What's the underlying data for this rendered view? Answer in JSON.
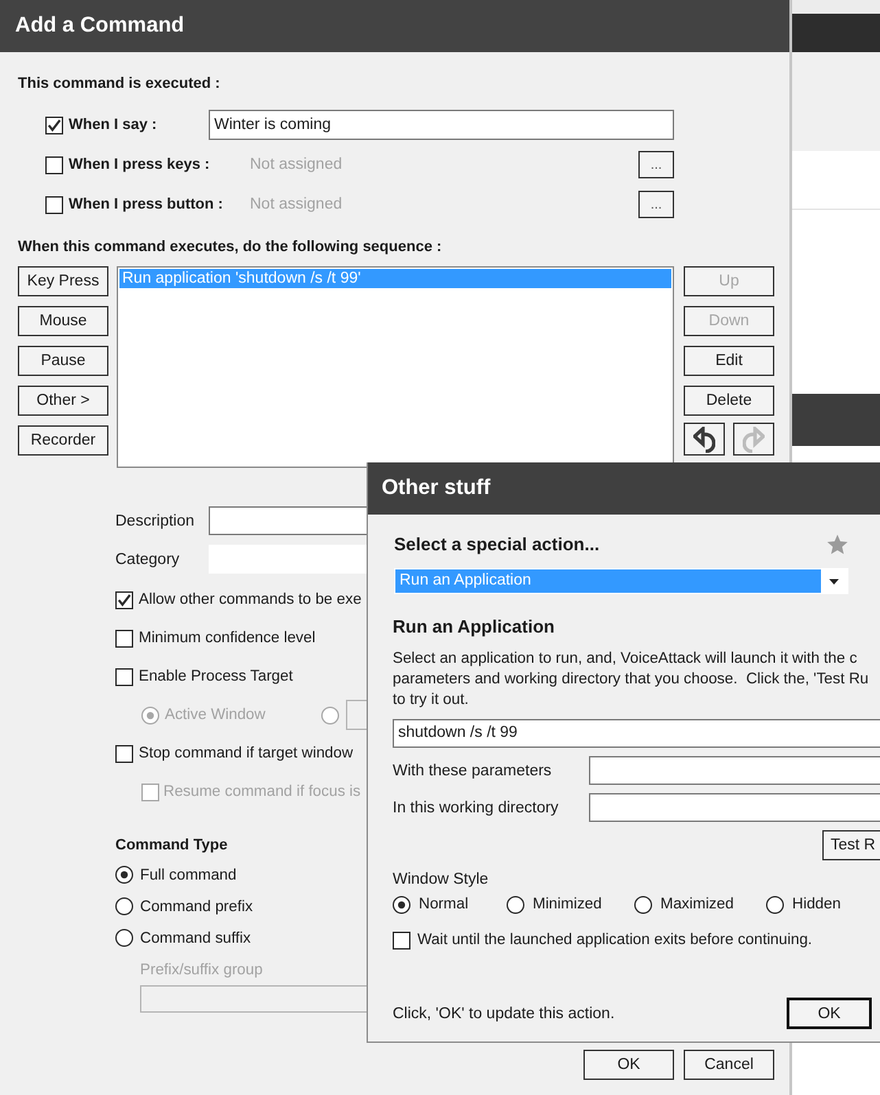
{
  "command_dialog": {
    "title": "Add a Command",
    "trigger_heading": "This command is executed :",
    "triggers": [
      {
        "kind": "phrase",
        "label": "When I say :",
        "checked": true,
        "value": "Winter is coming"
      },
      {
        "kind": "binding",
        "label": "When I press keys :",
        "checked": false,
        "value": "Not assigned",
        "button": "..."
      },
      {
        "kind": "binding",
        "label": "When I press button :",
        "checked": false,
        "value": "Not assigned",
        "button": "..."
      }
    ],
    "sequence_heading": "When this command executes, do the following sequence :",
    "add_buttons": [
      "Key Press",
      "Mouse",
      "Pause",
      "Other >",
      "Recorder"
    ],
    "actions": [
      {
        "label": "Run application 'shutdown /s /t 99'",
        "selected": true
      }
    ],
    "list_buttons": [
      {
        "label": "Up",
        "disabled": true
      },
      {
        "label": "Down",
        "disabled": true
      },
      {
        "label": "Edit",
        "disabled": false
      },
      {
        "label": "Delete",
        "disabled": false
      }
    ],
    "history_buttons": [
      {
        "kind": "undo",
        "disabled": false
      },
      {
        "kind": "redo",
        "disabled": true
      }
    ],
    "fields": [
      {
        "kind": "boxed",
        "label": "Description"
      },
      {
        "kind": "plain",
        "label": "Category"
      }
    ],
    "options": [
      {
        "kind": "checkbox",
        "label": "Allow other commands to be exe",
        "checked": true,
        "disabled": false
      },
      {
        "kind": "checkbox",
        "label": "Minimum confidence level",
        "checked": false,
        "disabled": false
      },
      {
        "kind": "checkbox",
        "label": "Enable Process Target",
        "checked": false,
        "disabled": false
      },
      {
        "kind": "radios",
        "disabled": true,
        "items": [
          {
            "label": "Active Window",
            "selected": true
          },
          {
            "selected": false
          }
        ]
      },
      {
        "kind": "checkbox",
        "label": "Stop command if target window",
        "checked": false,
        "disabled": false
      },
      {
        "kind": "subcheckbox",
        "label": "Resume command if focus is",
        "checked": false,
        "disabled": true
      }
    ],
    "type_heading": "Command Type",
    "command_types": [
      {
        "label": "Full command",
        "selected": true
      },
      {
        "label": "Command prefix",
        "selected": false
      },
      {
        "label": "Command suffix",
        "selected": false
      }
    ],
    "group_field": {
      "label": "Prefix/suffix group",
      "disabled": true
    },
    "buttons": [
      "OK",
      "Cancel"
    ]
  },
  "action_dialog": {
    "title": "Other stuff",
    "heading": "Select a special action...",
    "action_select": "Run an Application",
    "section_title": "Run an Application",
    "description": "Select an application to run, and, VoiceAttack will launch it with the c\nparameters and working directory that you choose.  Click the, 'Test Ru\nto try it out.",
    "path": "shutdown /s /t 99",
    "fields": [
      "With these parameters",
      "In this working directory"
    ],
    "test_button": "Test R",
    "window_style": {
      "label": "Window Style",
      "options": [
        {
          "label": "Normal",
          "selected": true
        },
        {
          "label": "Minimized",
          "selected": false
        },
        {
          "label": "Maximized",
          "selected": false
        },
        {
          "label": "Hidden",
          "selected": false
        }
      ]
    },
    "wait_option": {
      "label": "Wait until the launched application exits before continuing.",
      "checked": false
    },
    "hint": "Click, 'OK' to update this action.",
    "ok_button": "OK"
  }
}
